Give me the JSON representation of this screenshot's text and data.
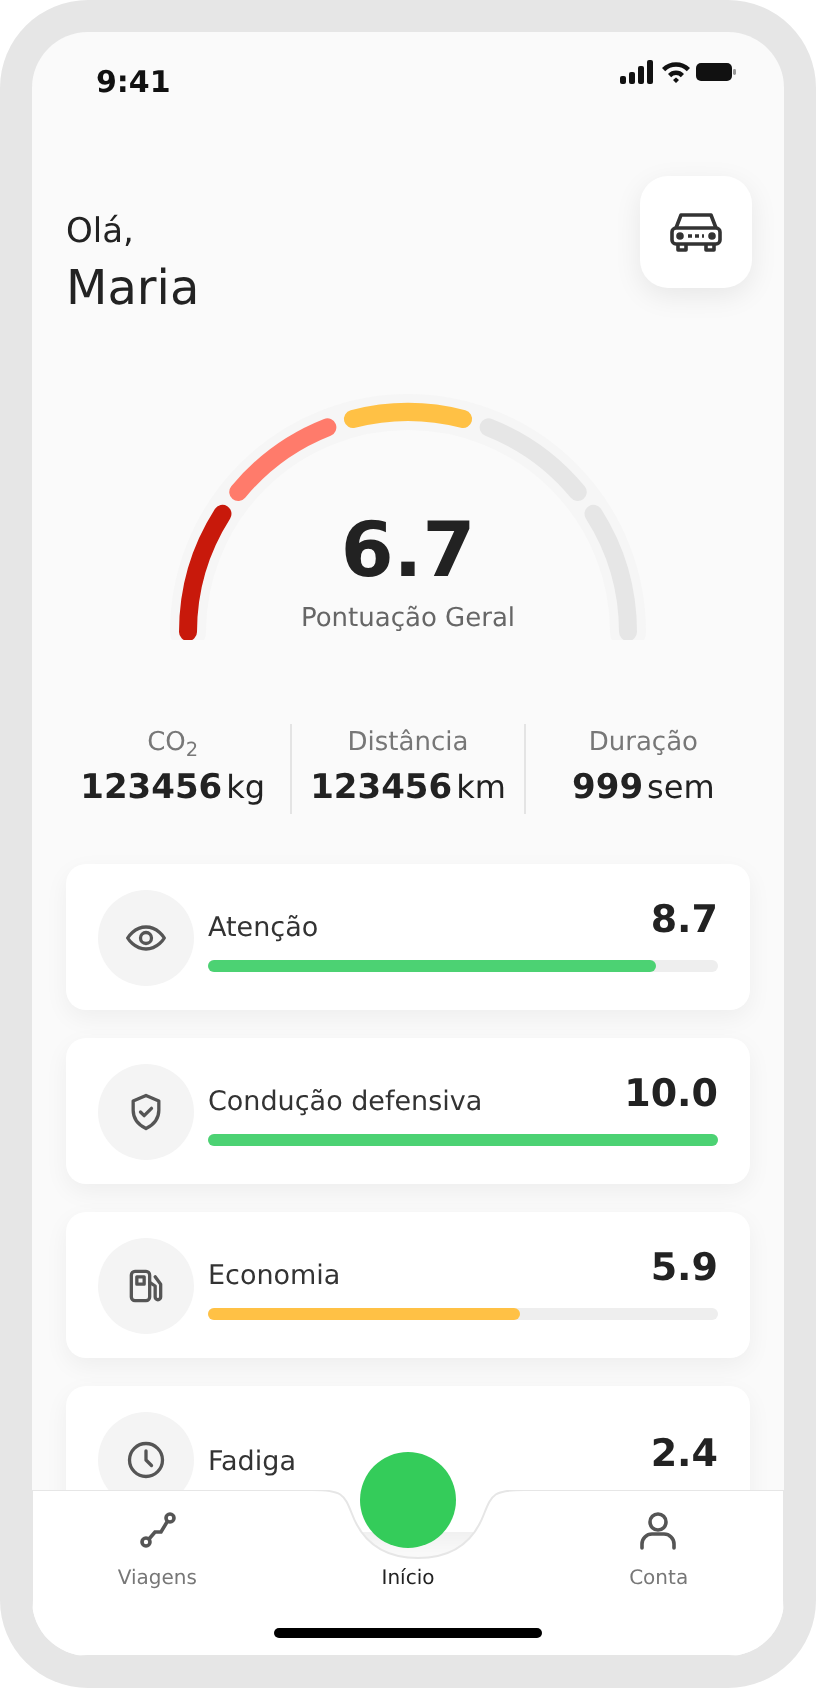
{
  "status_bar": {
    "time": "9:41"
  },
  "greeting": {
    "hello": "Olá,",
    "name": "Maria"
  },
  "gauge": {
    "score": "6.7",
    "label": "Pontuação Geral",
    "segments": [
      {
        "color": "#c8190b"
      },
      {
        "color": "#ff7b6b"
      },
      {
        "color": "#ffc145"
      },
      {
        "color": "#e6e6e6"
      },
      {
        "color": "#e6e6e6"
      }
    ]
  },
  "stats": [
    {
      "label": "CO$_{2}$",
      "value": "123456",
      "unit": "kg"
    },
    {
      "label": "Distância",
      "value": "123456",
      "unit": "km"
    },
    {
      "label": "Duração",
      "value": "999",
      "unit": "sem"
    }
  ],
  "metrics": [
    {
      "label": "Atenção",
      "value": "8.7",
      "level": 0.88,
      "color": "#4cd273"
    },
    {
      "label": "Condução defensiva",
      "value": "10.0",
      "level": 1,
      "color": "#4cd273"
    },
    {
      "label": "Economia",
      "value": "5.9",
      "level": 0.61,
      "color": "#ffc145"
    },
    {
      "label": "Fadiga",
      "value": "2.4"
    }
  ],
  "tab_bar": [
    {
      "label": "Viagens",
      "selected": false
    },
    {
      "label": "Início",
      "selected": true
    },
    {
      "label": "Conta",
      "selected": false
    }
  ]
}
